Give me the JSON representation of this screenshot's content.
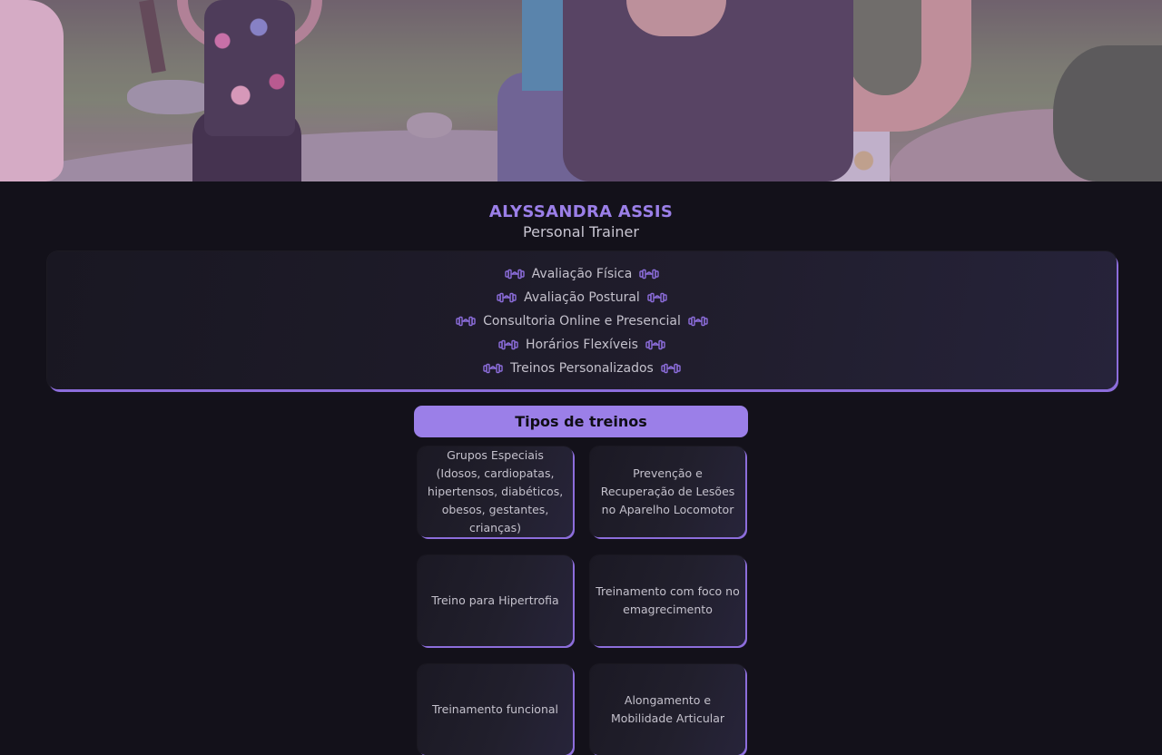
{
  "profile": {
    "name": "ALYSSANDRA ASSIS",
    "role": "Personal Trainer"
  },
  "services": [
    {
      "label": "Avaliação Física"
    },
    {
      "label": "Avaliação Postural"
    },
    {
      "label": "Consultoria Online e Presencial"
    },
    {
      "label": "Horários Flexíveis"
    },
    {
      "label": "Treinos Personalizados"
    }
  ],
  "service_icon": "dumbbell-icon",
  "types": {
    "title": "Tipos de treinos",
    "cards": [
      {
        "label": "Grupos Especiais (Idosos, cardiopatas, hipertensos, diabéticos, obesos, gestantes, crianças)"
      },
      {
        "label": "Prevenção e Recuperação de Lesões no Aparelho Locomotor"
      },
      {
        "label": "Treino para Hipertrofia"
      },
      {
        "label": "Treinamento com foco no emagrecimento"
      },
      {
        "label": "Treinamento funcional"
      },
      {
        "label": "Alongamento e Mobilidade Articular"
      }
    ]
  },
  "colors": {
    "accent": "#9b7fe8",
    "background": "#13111a",
    "text": "#c4c1cc"
  }
}
